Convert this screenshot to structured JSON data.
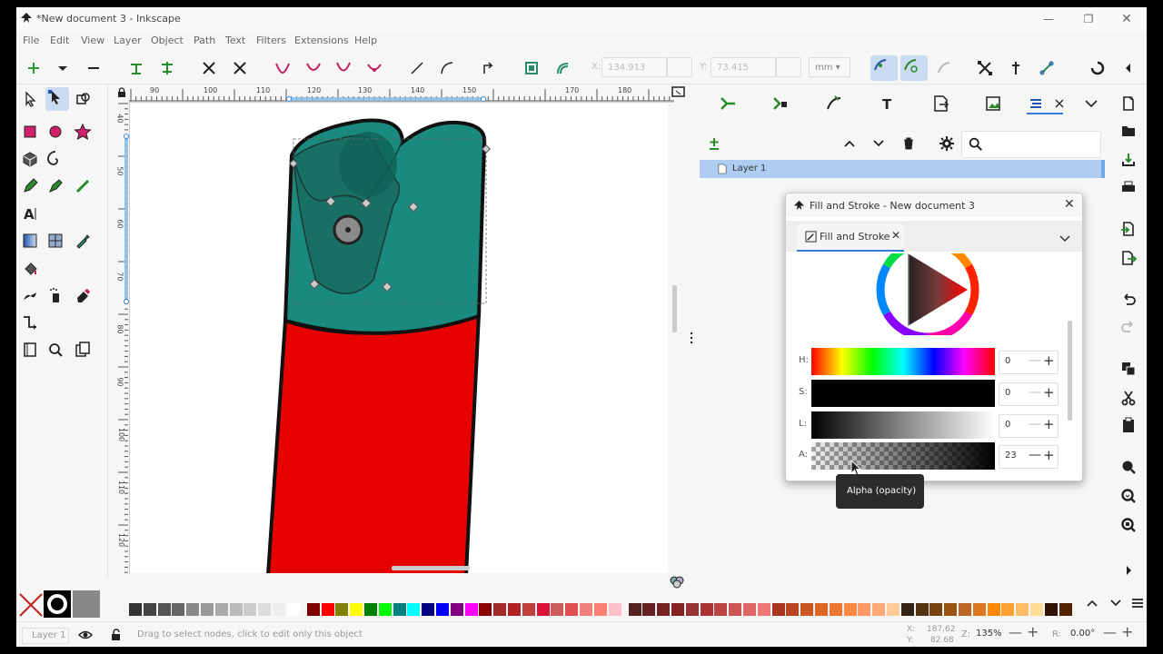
{
  "window": {
    "title": "*New document 3 - Inkscape",
    "min_icon": "minimize-icon",
    "max_icon": "maximize-icon",
    "close_icon": "close-icon"
  },
  "menu": [
    "File",
    "Edit",
    "View",
    "Layer",
    "Object",
    "Path",
    "Text",
    "Filters",
    "Extensions",
    "Help"
  ],
  "toolbar": {
    "x_label": "X:",
    "x_value": "134.913",
    "y_label": "Y:",
    "y_value": "73.415",
    "unit": "mm"
  },
  "ruler": {
    "h_ticks": [
      "90",
      "100",
      "110",
      "120",
      "130",
      "140",
      "150",
      "170",
      "180"
    ],
    "v_ticks": [
      "40",
      "50",
      "60",
      "70",
      "80",
      "90",
      "100",
      "110",
      "120"
    ]
  },
  "layers_panel": {
    "layer_name": "Layer 1"
  },
  "dialog": {
    "title": "Fill and Stroke - New document 3",
    "tab": "Fill and Stroke",
    "sliders": [
      {
        "label": "H:",
        "value": "0"
      },
      {
        "label": "S:",
        "value": "0"
      },
      {
        "label": "L:",
        "value": "0"
      },
      {
        "label": "A:",
        "value": "23"
      }
    ]
  },
  "tooltip": "Alpha (opacity)",
  "palette": {
    "colors": [
      "#333333",
      "#444444",
      "#555555",
      "#666666",
      "#888888",
      "#999999",
      "#aaaaaa",
      "#bbbbbb",
      "#cccccc",
      "#dddddd",
      "#eeeeee",
      "#ffffff",
      "#800000",
      "#ff0000",
      "#808000",
      "#ffff00",
      "#008000",
      "#00ff00",
      "#008080",
      "#00ffff",
      "#000080",
      "#0000ff",
      "#800080",
      "#ff00ff",
      "#8b0000",
      "#a52a2a",
      "#b22222",
      "#c04040",
      "#dc143c",
      "#cd5c5c",
      "#e05050",
      "#f08080",
      "#fa8072",
      "#ffc0cb",
      "#552222",
      "#662222",
      "#772222",
      "#882222",
      "#993333",
      "#aa3333",
      "#bb4444",
      "#cc5555",
      "#dd6666",
      "#ee7777",
      "#aa3322",
      "#bb4422",
      "#cc5522",
      "#dd6622",
      "#ee7733",
      "#ff8844",
      "#ff9966",
      "#ffaa77",
      "#ffcc99",
      "#332211",
      "#553311",
      "#774411",
      "#995511",
      "#bb6622",
      "#dd7722",
      "#ff8800",
      "#ffa033",
      "#ffbb66",
      "#ffdd99",
      "#331100",
      "#552200"
    ]
  },
  "status": {
    "layer": "Layer 1",
    "message": "Drag to select nodes, click to edit only this object",
    "x_label": "X:",
    "x_value": "187.62",
    "y_label": "Y:",
    "y_value": "82.68",
    "zoom_label": "Z:",
    "zoom": "135%",
    "rotate_label": "R:",
    "rotation": "0.00°"
  }
}
